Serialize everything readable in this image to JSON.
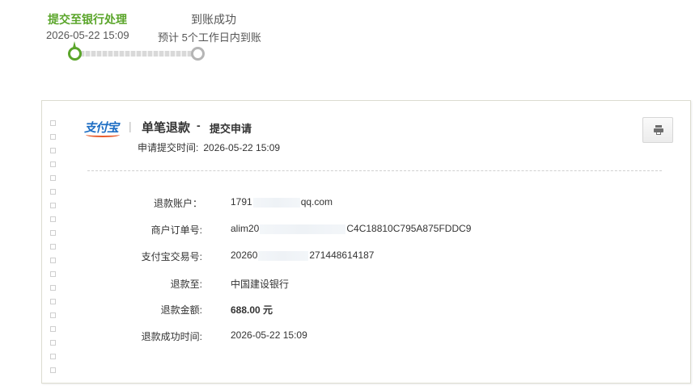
{
  "progress": {
    "step1": {
      "title": "提交至银行处理",
      "time": "2026-05-22 15:09",
      "status": "done"
    },
    "step2": {
      "title": "到账成功",
      "note": "预计 5个工作日内到账",
      "status": "pending"
    },
    "accent_color": "#5aa52a",
    "pending_color": "#b5b5b5"
  },
  "receipt": {
    "logo_text": "支付宝",
    "separator": "|",
    "title": "单笔退款",
    "dash": "-",
    "subtitle": "提交申请",
    "apply_time_label": "申请提交时间:",
    "apply_time_value": "2026-05-22 15:09",
    "print_icon": "printer-icon",
    "rows": [
      {
        "label": "退款账户：",
        "value_prefix": "1791",
        "value_suffix": "qq.com",
        "redacted": true
      },
      {
        "label": "商户订单号:",
        "value_prefix": "alim20",
        "value_suffix": "C4C18810C795A875FDDC9",
        "redacted": true
      },
      {
        "label": "支付宝交易号:",
        "value_prefix": "20260",
        "value_suffix": "271448614187",
        "redacted": true
      },
      {
        "label": "退款至:",
        "value": "中国建设银行"
      },
      {
        "label": "退款金额:",
        "value": "688.00 元"
      },
      {
        "label": "退款成功时间:",
        "value": "2026-05-22 15:09"
      }
    ]
  }
}
